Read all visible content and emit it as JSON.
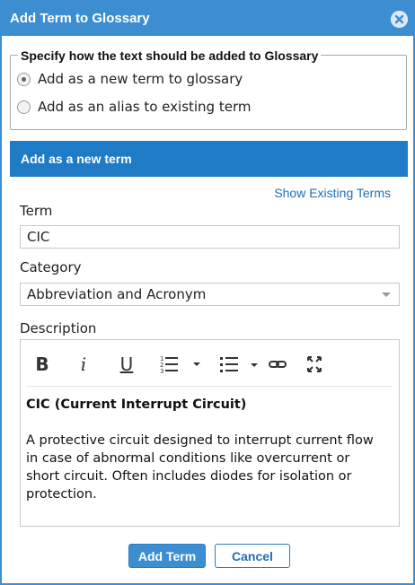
{
  "dialog": {
    "title": "Add Term to Glossary"
  },
  "options": {
    "legend": "Specify how the text should be added to Glossary",
    "choices": [
      {
        "label": "Add as a new term to glossary",
        "selected": true
      },
      {
        "label": "Add as an alias to existing term",
        "selected": false
      }
    ]
  },
  "section": {
    "header": "Add as a new term",
    "show_existing_link": "Show Existing Terms"
  },
  "fields": {
    "term_label": "Term",
    "term_value": "CIC",
    "category_label": "Category",
    "category_value": "Abbreviation and Acronym",
    "description_label": "Description"
  },
  "editor": {
    "toolbar": [
      "bold-icon",
      "italic-icon",
      "underline-icon",
      "ordered-list-icon",
      "bullet-list-icon",
      "link-icon",
      "fullscreen-icon"
    ],
    "bold_glyph": "B",
    "italic_glyph": "i",
    "underline_glyph": "U",
    "heading": "CIC (Current Interrupt Circuit)",
    "body": "A protective circuit designed to interrupt current flow in case of abnormal conditions like overcurrent or short circuit. Often includes diodes for isolation or protection."
  },
  "buttons": {
    "add": "Add Term",
    "cancel": "Cancel"
  },
  "colors": {
    "title_bar": "#3c8ed0",
    "section_header": "#1f7bc6",
    "link": "#1f6fb5"
  }
}
